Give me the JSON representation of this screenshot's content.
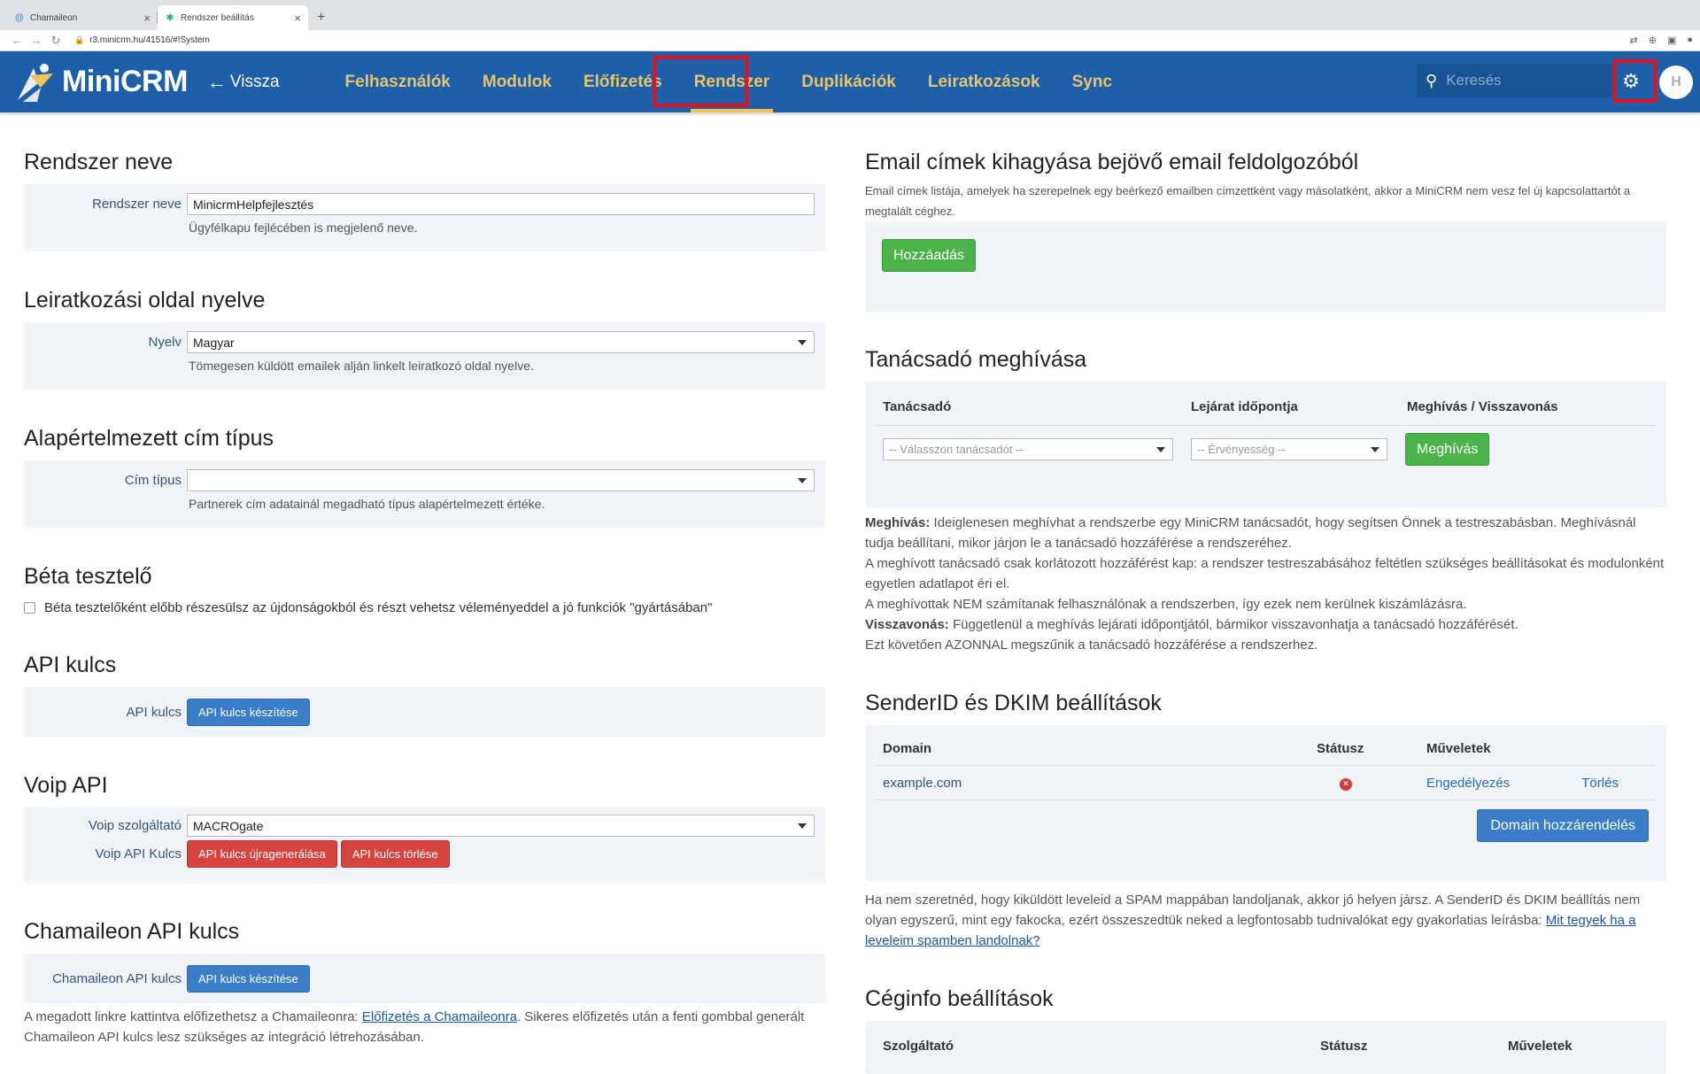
{
  "browser": {
    "tabs": [
      {
        "title": "Chamaileon",
        "favicon": "chamaileon-icon",
        "active": false
      },
      {
        "title": "Rendszer beállítás",
        "favicon": "minicrm-icon",
        "active": true
      }
    ],
    "new_tab": "+",
    "url": "r3.minicrm.hu/41516/#!System"
  },
  "header": {
    "logo_text": "MiniCRM",
    "back_label": "Vissza",
    "nav": [
      "Felhasználók",
      "Modulok",
      "Előfizetés",
      "Rendszer",
      "Duplikációk",
      "Leiratkozások",
      "Sync"
    ],
    "active_nav": "Rendszer",
    "search_placeholder": "Keresés",
    "colors": {
      "bar": "#1d5fa8",
      "nav_text": "#e8c46a",
      "highlight": "#e0121f"
    }
  },
  "left": {
    "system_name": {
      "title": "Rendszer neve",
      "label": "Rendszer neve",
      "value": "MinicrmHelpfejlesztés",
      "help": "Ügyfélkapu fejlécében is megjelenő neve."
    },
    "unsub_lang": {
      "title": "Leiratkozási oldal nyelve",
      "label": "Nyelv",
      "value": "Magyar",
      "help": "Tömegesen küldött emailek alján linkelt leiratkozó oldal nyelve."
    },
    "address_type": {
      "title": "Alapértelmezett cím típus",
      "label": "Cím típus",
      "value": "",
      "help": "Partnerek cím adatainál megadható típus alapértelmezett értéke."
    },
    "beta": {
      "title": "Béta tesztelő",
      "checkbox_label": "Béta tesztelőként előbb részesülsz az újdonságokból és részt vehetsz véleményeddel a jó funkciók \"gyártásában\""
    },
    "api": {
      "title": "API kulcs",
      "label": "API kulcs",
      "button": "API kulcs készítése"
    },
    "voip": {
      "title": "Voip API",
      "provider_label": "Voip szolgáltató",
      "provider_value": "MACROgate",
      "key_label": "Voip API Kulcs",
      "regen_button": "API kulcs újragenerálása",
      "delete_button": "API kulcs törlése"
    },
    "chamaileon": {
      "title": "Chamaileon API kulcs",
      "label": "Chamaileon API kulcs",
      "button": "API kulcs készítése",
      "note_before": "A megadott linkre kattintva előfizethetsz a Chamaileonra: ",
      "note_link": "Előfizetés a Chamaileonra",
      "note_after": ". Sikeres előfizetés után a fenti gombbal generált Chamaileon API kulcs lesz szükséges az integráció létrehozásában."
    }
  },
  "right": {
    "email_skip": {
      "title": "Email címek kihagyása bejövő email feldolgozóból",
      "desc": "Email címek listája, amelyek ha szerepelnek egy beérkező emailben címzettként vagy másolatként, akkor a MiniCRM nem vesz fel új kapcsolattartót a megtalált céghez.",
      "button": "Hozzáadás"
    },
    "consultant": {
      "title": "Tanácsadó meghívása",
      "col_consultant": "Tanácsadó",
      "col_expiry": "Lejárat időpontja",
      "col_action": "Meghívás / Visszavonás",
      "consultant_placeholder": "-- Válasszon tanácsadót --",
      "expiry_placeholder": "-- Érvényesség --",
      "invite_button": "Meghívás",
      "p1_bold": "Meghívás:",
      "p1": " Ideiglenesen meghívhat a rendszerbe egy MiniCRM tanácsadót, hogy segítsen Önnek a testreszabásban. Meghívásnál tudja beállítani, mikor járjon le a tanácsadó hozzáférése a rendszeréhez.",
      "p2": "A meghívott tanácsadó csak korlátozott hozzáférést kap: a rendszer testreszabásához feltétlen szükséges beállításokat és modulonként egyetlen adatlapot éri el.",
      "p3": "A meghívottak NEM számítanak felhasználónak a rendszerben, így ezek nem kerülnek kiszámlázásra.",
      "p4_bold": "Visszavonás:",
      "p4": " Függetlenül a meghívás lejárati időpontjától, bármikor visszavonhatja a tanácsadó hozzáférését.",
      "p5": "Ezt követően AZONNAL megszűnik a tanácsadó hozzáférése a rendszerhez."
    },
    "dkim": {
      "title": "SenderID és DKIM beállítások",
      "col_domain": "Domain",
      "col_status": "Státusz",
      "col_actions": "Műveletek",
      "rows": [
        {
          "domain": "example.com",
          "status": "error",
          "enable": "Engedélyezés",
          "delete": "Törlés"
        }
      ],
      "assign_button": "Domain hozzárendelés",
      "note_before": "Ha nem szeretnéd, hogy kiküldött leveleid a SPAM mappában landoljanak, akkor jó helyen jársz. A SenderID és DKIM beállítás nem olyan egyszerű, mint egy fakocka, ezért összeszedtük neked a legfontosabb tudnivalókat egy gyakorlatias leírásba: ",
      "note_link": "Mit tegyek ha a leveleim spamben landolnak?"
    },
    "companyinfo": {
      "title": "Céginfo beállítások",
      "col_provider": "Szolgáltató",
      "col_status": "Státusz",
      "col_actions": "Műveletek"
    }
  }
}
